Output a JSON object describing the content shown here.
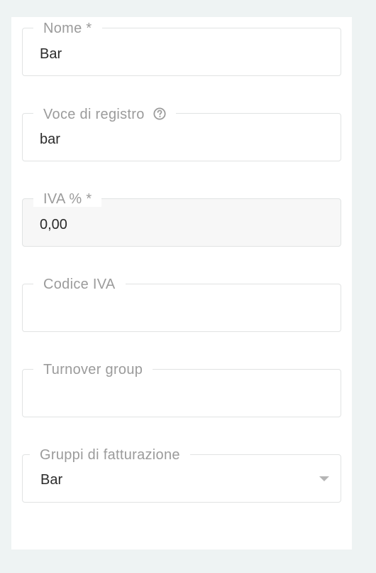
{
  "form": {
    "nome": {
      "label": "Nome *",
      "value": "Bar"
    },
    "voce_di_registro": {
      "label": "Voce di registro",
      "value": "bar",
      "help_icon": "question-circle-icon"
    },
    "iva": {
      "label": "IVA % *",
      "value": "0,00"
    },
    "codice_iva": {
      "label": "Codice IVA",
      "value": ""
    },
    "turnover_group": {
      "label": "Turnover group",
      "value": ""
    },
    "gruppi_di_fatturazione": {
      "label": "Gruppi di fatturazione",
      "value": "Bar",
      "dropdown_icon": "chevron-down-icon"
    }
  },
  "colors": {
    "page_background": "#eef3f3",
    "panel_background": "#ffffff",
    "border": "#e1e3e3",
    "label_text": "#9b9b9b",
    "value_text": "#2b2b2b",
    "disabled_background": "#f7f7f7"
  }
}
